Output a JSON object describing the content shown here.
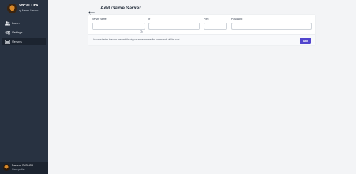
{
  "brand": {
    "title": "Social Link",
    "subtitle": "by Naven Servers"
  },
  "sidebar": {
    "items": [
      {
        "label": "Users",
        "icon": "users-icon"
      },
      {
        "label": "Settings",
        "icon": "gears-icon"
      },
      {
        "label": "Servers",
        "icon": "server-icon",
        "active": true
      }
    ]
  },
  "user": {
    "name": "Naveno XVSLCX",
    "link": "View profile"
  },
  "header": {
    "title": "Add Game Server"
  },
  "form": {
    "server_name": {
      "label": "Server Name",
      "value": "",
      "placeholder": ""
    },
    "ip": {
      "label": "IP",
      "value": "",
      "placeholder": ""
    },
    "port": {
      "label": "Port",
      "value": "",
      "placeholder": ""
    },
    "password": {
      "label": "Password",
      "value": "",
      "placeholder": ""
    },
    "help_text": "You must enter the rcon credentials of your server where the commands will be sent.",
    "add_label": "Add"
  },
  "colors": {
    "sidebar": "#283241",
    "accent": "#5145cd",
    "background": "#f3f4f6"
  }
}
